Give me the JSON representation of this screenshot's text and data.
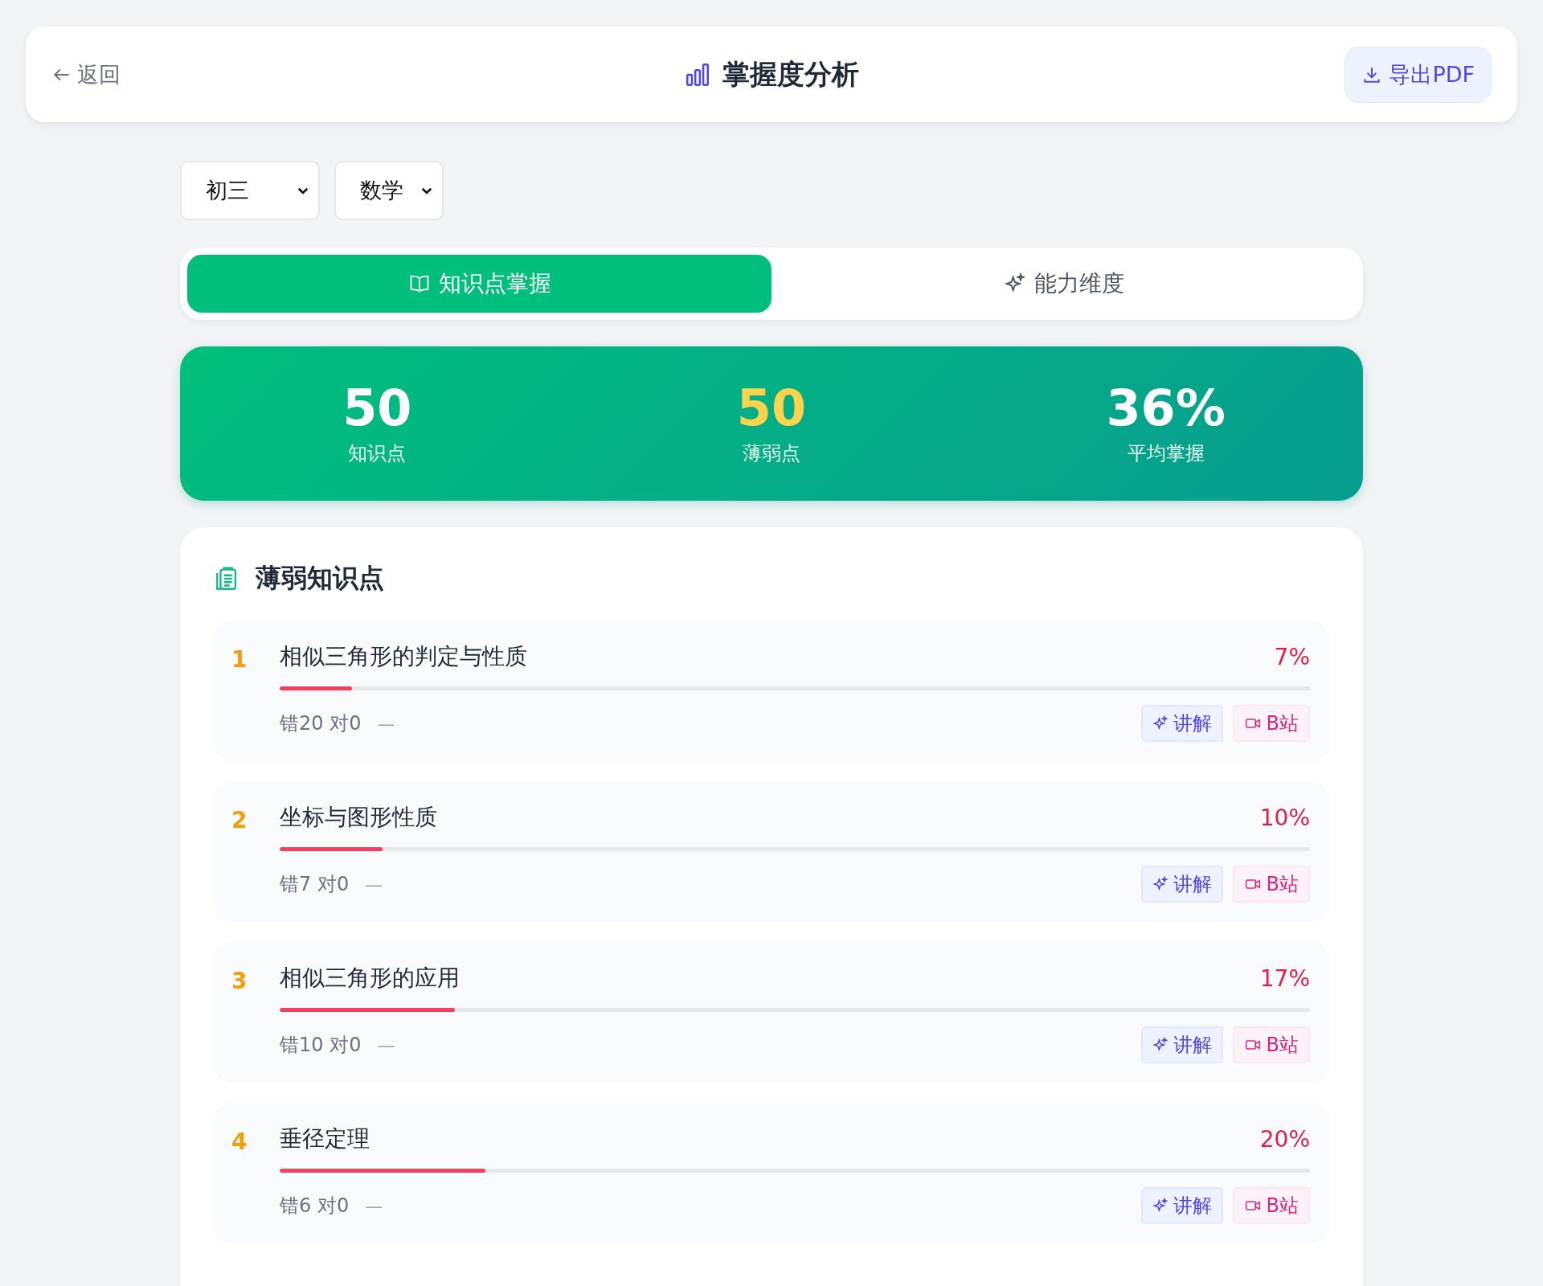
{
  "header": {
    "back": "返回",
    "title": "掌握度分析",
    "export": "导出PDF"
  },
  "filters": [
    {
      "value": "初三"
    },
    {
      "value": "数学"
    }
  ],
  "tabs": [
    {
      "label": "知识点掌握",
      "selected": true,
      "kind": "knowledge"
    },
    {
      "label": "能力维度",
      "selected": false,
      "kind": "ability"
    }
  ],
  "stats": [
    {
      "value": "50",
      "label": "知识点",
      "highlight": false
    },
    {
      "value": "50",
      "label": "薄弱点",
      "highlight": true
    },
    {
      "value": "36%",
      "label": "平均掌握",
      "highlight": false
    }
  ],
  "weak": {
    "title": "薄弱知识点",
    "items": [
      {
        "rank": "1",
        "name": "相似三角形的判定与性质",
        "percent": "7%",
        "level": 0.07,
        "record": "错20 对0",
        "trend": "—",
        "actions": [
          {
            "kind": "explain",
            "label": "讲解"
          },
          {
            "kind": "video",
            "label": "B站"
          }
        ]
      },
      {
        "rank": "2",
        "name": "坐标与图形性质",
        "percent": "10%",
        "level": 0.1,
        "record": "错7 对0",
        "trend": "—",
        "actions": [
          {
            "kind": "explain",
            "label": "讲解"
          },
          {
            "kind": "video",
            "label": "B站"
          }
        ]
      },
      {
        "rank": "3",
        "name": "相似三角形的应用",
        "percent": "17%",
        "level": 0.17,
        "record": "错10 对0",
        "trend": "—",
        "actions": [
          {
            "kind": "explain",
            "label": "讲解"
          },
          {
            "kind": "video",
            "label": "B站"
          }
        ]
      },
      {
        "rank": "4",
        "name": "垂径定理",
        "percent": "20%",
        "level": 0.2,
        "record": "错6 对0",
        "trend": "—",
        "actions": [
          {
            "kind": "explain",
            "label": "讲解"
          },
          {
            "kind": "video",
            "label": "B站"
          }
        ]
      }
    ]
  }
}
